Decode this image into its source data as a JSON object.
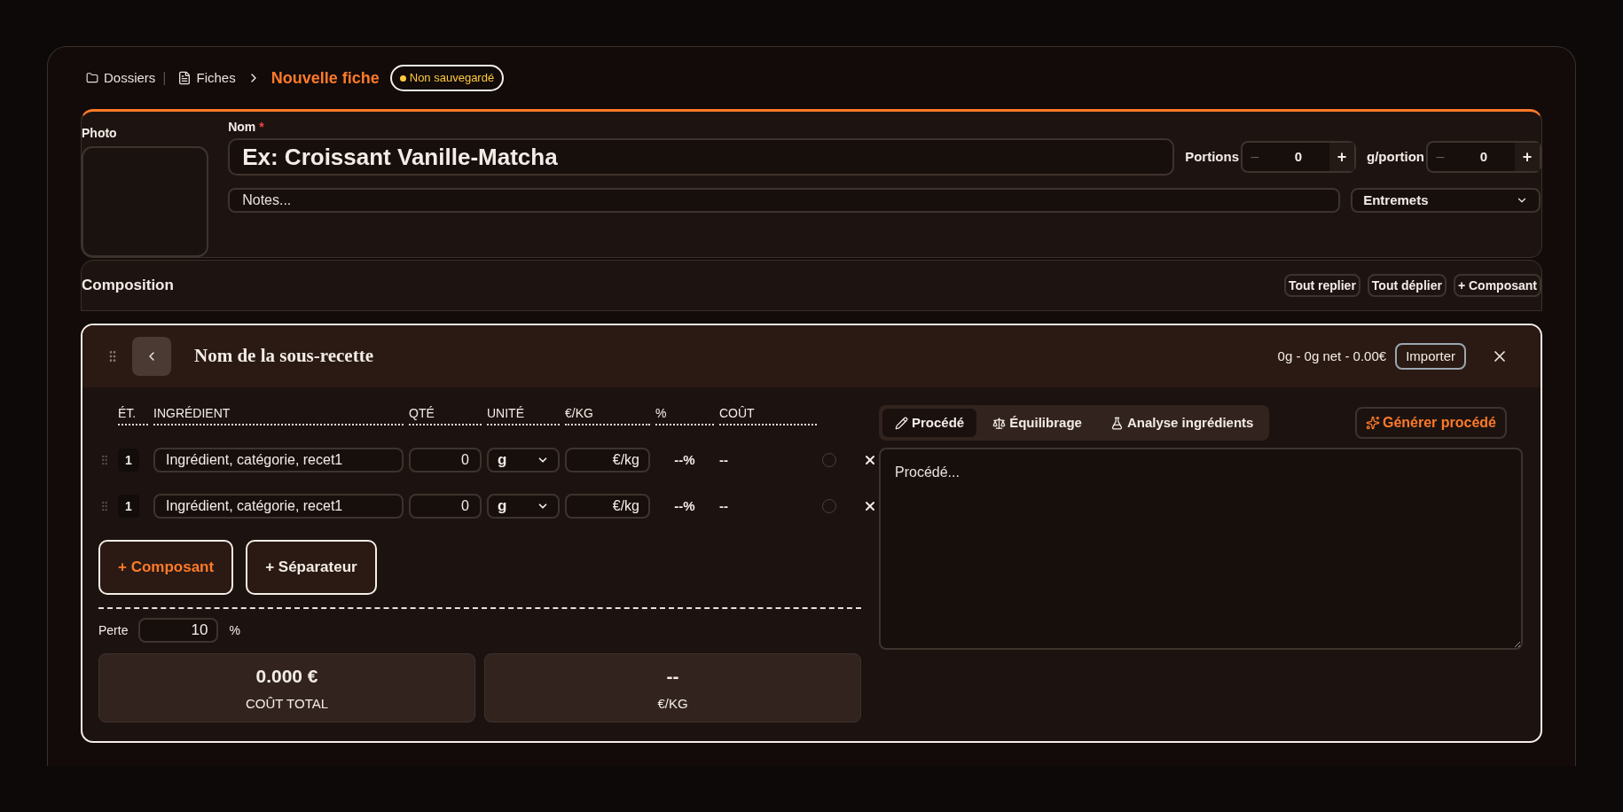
{
  "breadcrumb": {
    "items": [
      {
        "label": "Dossiers"
      },
      {
        "label": "Fiches"
      }
    ],
    "separator": "|",
    "current": "Nouvelle fiche",
    "status": "Non sauvegardé"
  },
  "fiche": {
    "photo_label": "Photo",
    "name_label": "Nom",
    "name_required": "*",
    "name_placeholder": "Ex: Croissant Vanille-Matcha",
    "notes_placeholder": "Notes...",
    "steppers": [
      {
        "label": "Portions",
        "minus": "–",
        "value": "0",
        "plus": "+"
      },
      {
        "label": "g/portion",
        "minus": "–",
        "value": "0",
        "plus": "+"
      }
    ],
    "category": "Entremets"
  },
  "composition": {
    "title": "Composition",
    "buttons": [
      "Tout replier",
      "Tout déplier",
      "+ Composant"
    ]
  },
  "subrecipe": {
    "title": "Nom de la sous-recette",
    "summary": "0g - 0g net - 0.00€",
    "import_button": "Importer",
    "columns": [
      "ÉT.",
      "INGRÉDIENT",
      "QTÉ",
      "UNITÉ",
      "€/KG",
      "%",
      "COÛT"
    ],
    "rows": [
      {
        "step": "1",
        "ingredient_placeholder": "Ingrédient, catégorie, recet1",
        "qty": "0",
        "unit": "g",
        "price_placeholder": "€/kg",
        "percent": "--%",
        "cost": "--",
        "checked": false
      },
      {
        "step": "1",
        "ingredient_placeholder": "Ingrédient, catégorie, recet1",
        "qty": "0",
        "unit": "g",
        "price_placeholder": "€/kg",
        "percent": "--%",
        "cost": "--",
        "checked": false
      }
    ],
    "add_buttons": [
      {
        "label": "+ Composant",
        "kind": "accent"
      },
      {
        "label": "+ Séparateur",
        "kind": "plain"
      }
    ],
    "loss": {
      "label": "Perte",
      "value": "10",
      "unit": "%"
    },
    "totals": [
      {
        "value": "0.000 €",
        "label": "COÛT TOTAL"
      },
      {
        "value": "--",
        "label": "€/KG"
      }
    ],
    "tabs": [
      {
        "label": "Procédé",
        "selected": true
      },
      {
        "label": "Équilibrage",
        "selected": false
      },
      {
        "label": "Analyse ingrédients",
        "selected": false
      }
    ],
    "generate_button": "Générer procédé",
    "procedure_placeholder": "Procédé..."
  }
}
